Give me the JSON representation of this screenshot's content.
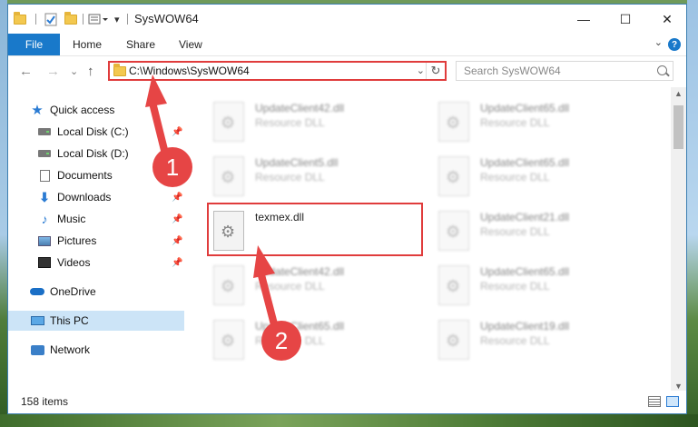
{
  "window": {
    "title": "SysWOW64",
    "controls": {
      "minimize": "—",
      "maximize": "☐",
      "close": "✕"
    }
  },
  "ribbon": {
    "tabs": [
      "File",
      "Home",
      "Share",
      "View"
    ],
    "help_label": "?"
  },
  "nav": {
    "back": "←",
    "forward": "→",
    "recent": "⌄",
    "up": "↑",
    "address": "C:\\Windows\\SysWOW64",
    "refresh": "↻",
    "search_placeholder": "Search SysWOW64"
  },
  "sidebar": {
    "items": [
      {
        "label": "Quick access",
        "icon": "star-icon"
      },
      {
        "label": "Local Disk (C:)",
        "icon": "drive-icon",
        "pinned": true
      },
      {
        "label": "Local Disk (D:)",
        "icon": "drive-icon",
        "pinned": true
      },
      {
        "label": "Documents",
        "icon": "documents-icon",
        "pinned": true
      },
      {
        "label": "Downloads",
        "icon": "downloads-icon",
        "pinned": true
      },
      {
        "label": "Music",
        "icon": "music-icon",
        "pinned": true
      },
      {
        "label": "Pictures",
        "icon": "pictures-icon",
        "pinned": true
      },
      {
        "label": "Videos",
        "icon": "videos-icon",
        "pinned": true
      },
      {
        "label": "OneDrive",
        "icon": "onedrive-icon"
      },
      {
        "label": "This PC",
        "icon": "pc-icon",
        "selected": true
      },
      {
        "label": "Network",
        "icon": "network-icon"
      }
    ]
  },
  "files": [
    {
      "name": "UpdateClient42.dll",
      "type": "Resource DLL"
    },
    {
      "name": "UpdateClient65.dll",
      "type": "Resource DLL"
    },
    {
      "name": "UpdateClient5.dll",
      "type": "Resource DLL"
    },
    {
      "name": "UpdateClient65.dll",
      "type": "Resource DLL"
    },
    {
      "name": "texmex.dll",
      "type": ""
    },
    {
      "name": "UpdateClient21.dll",
      "type": "Resource DLL"
    },
    {
      "name": "UpdateClient42.dll",
      "type": "Resource DLL"
    },
    {
      "name": "UpdateClient65.dll",
      "type": "Resource DLL"
    },
    {
      "name": "UpdateClient65.dll",
      "type": "Resource DLL"
    },
    {
      "name": "UpdateClient19.dll",
      "type": "Resource DLL"
    }
  ],
  "status": {
    "item_count": "158 items"
  },
  "annotations": {
    "step1": "1",
    "step2": "2",
    "accent_color": "#e64545"
  }
}
